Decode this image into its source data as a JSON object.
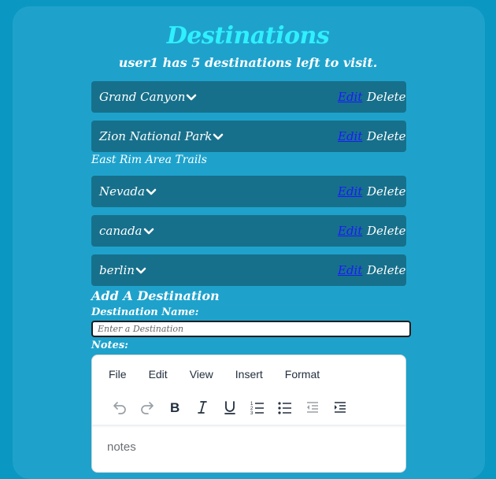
{
  "header": {
    "title": "Destinations",
    "subtitle": "user1 has 5 destinations left to visit."
  },
  "destinations": [
    {
      "name": "Grand Canyon",
      "edit_label": "Edit",
      "delete_label": "Delete"
    },
    {
      "name": "Zion National Park",
      "edit_label": "Edit",
      "delete_label": "Delete",
      "note": "East Rim Area Trails"
    },
    {
      "name": "Nevada",
      "edit_label": "Edit",
      "delete_label": "Delete"
    },
    {
      "name": "canada",
      "edit_label": "Edit",
      "delete_label": "Delete"
    },
    {
      "name": "berlin",
      "edit_label": "Edit",
      "delete_label": "Delete"
    }
  ],
  "form": {
    "heading": "Add A Destination",
    "name_label": "Destination Name:",
    "name_placeholder": "Enter a Destination",
    "name_value": "",
    "notes_label": "Notes:"
  },
  "editor": {
    "menu": [
      "File",
      "Edit",
      "View",
      "Insert",
      "Format"
    ],
    "toolbar_icons": [
      "undo-icon",
      "redo-icon",
      "bold-icon",
      "italic-icon",
      "underline-icon",
      "numbered-list-icon",
      "bullet-list-icon",
      "outdent-icon",
      "indent-icon"
    ],
    "placeholder": "notes"
  },
  "colors": {
    "background": "#0a98c2",
    "panel": "#1ea2cc",
    "title": "#2ff0ff",
    "row": "#17708b",
    "link": "#1a1aff"
  }
}
